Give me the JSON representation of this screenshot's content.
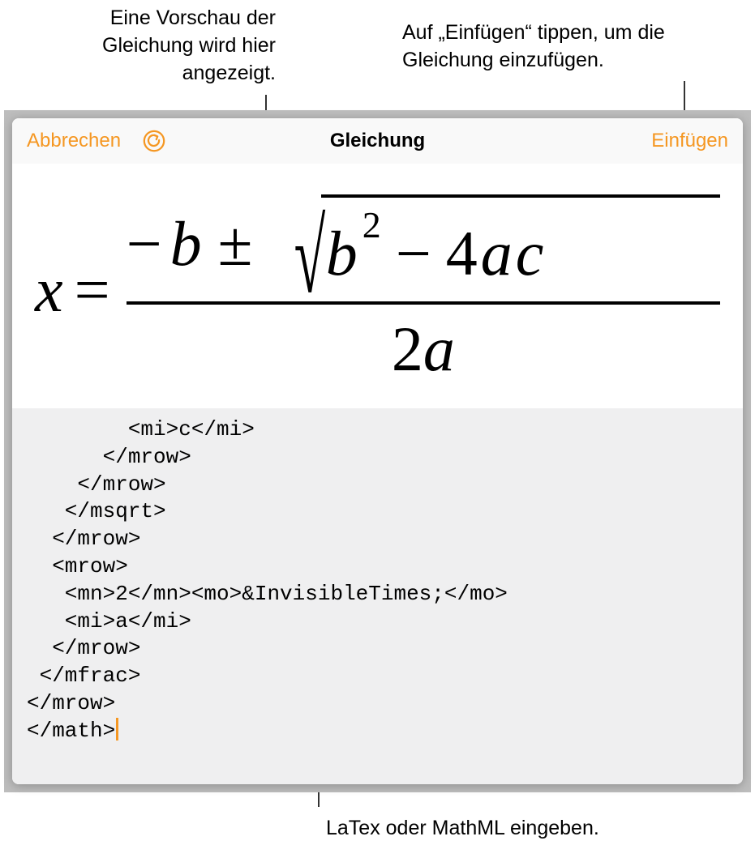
{
  "callouts": {
    "preview": "Eine Vorschau der\nGleichung wird\nhier angezeigt.",
    "insert": "Auf „Einfügen“ tippen, um\ndie Gleichung einzufügen.",
    "input": "LaTex oder MathML eingeben."
  },
  "toolbar": {
    "cancel": "Abbrechen",
    "title": "Gleichung",
    "insert": "Einfügen"
  },
  "equation": {
    "x": "x",
    "eq": "=",
    "minus": "−",
    "b": "b",
    "pm": "±",
    "sqrt_b": "b",
    "sqrt_exp": "2",
    "sqrt_minus": "−",
    "sqrt_4": "4",
    "sqrt_a": "a",
    "sqrt_c": "c",
    "den_2": "2",
    "den_a": "a"
  },
  "code": "        <mi>c</mi>\n      </mrow>\n    </mrow>\n   </msqrt>\n  </mrow>\n  <mrow>\n   <mn>2</mn><mo>&InvisibleTimes;</mo>\n   <mi>a</mi>\n  </mrow>\n </mfrac>\n</mrow>\n</math>"
}
